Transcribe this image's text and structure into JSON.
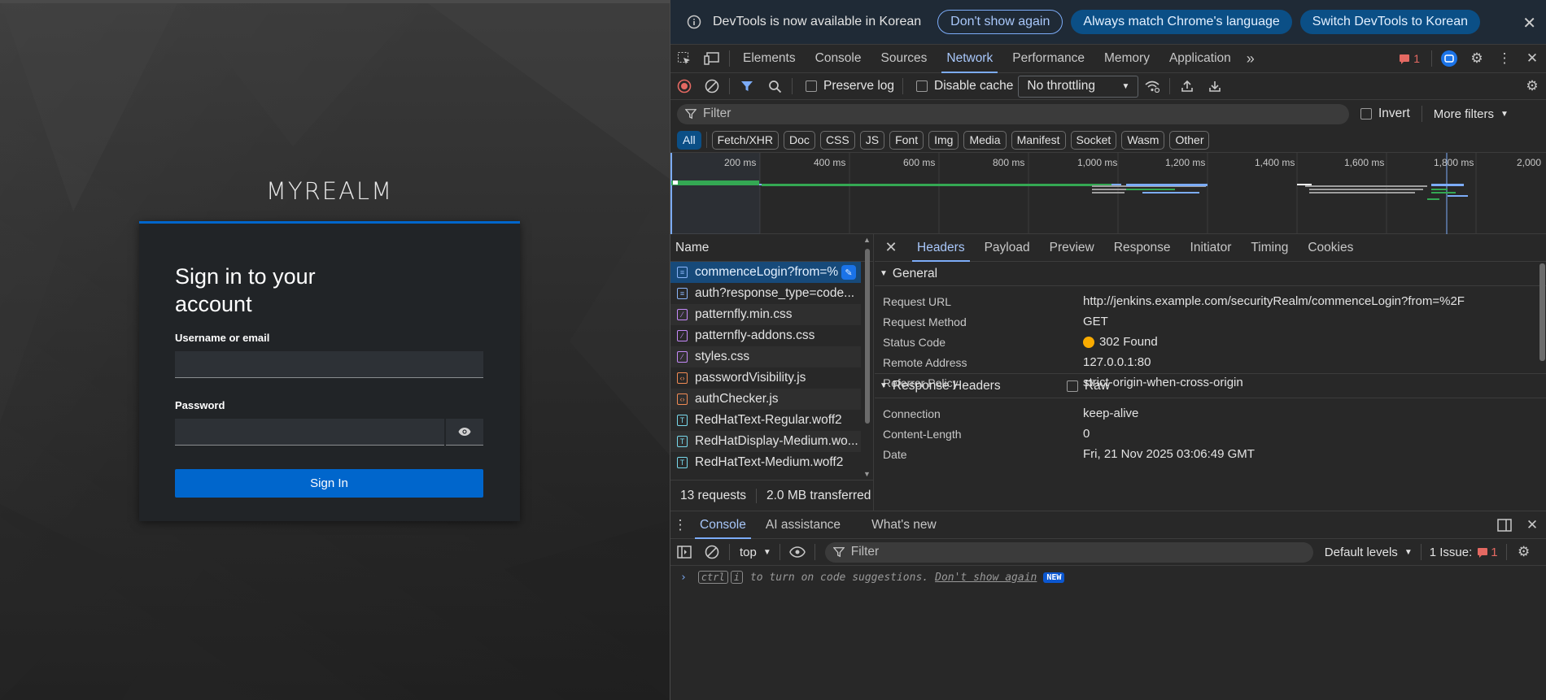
{
  "login": {
    "realm": "MYREALM",
    "heading": "Sign in to your account",
    "username_label": "Username or email",
    "username_value": "",
    "password_label": "Password",
    "password_value": "",
    "signin_label": "Sign In"
  },
  "infobar": {
    "message": "DevTools is now available in Korean",
    "dont_show": "Don't show again",
    "match_language": "Always match Chrome's language",
    "switch_korean": "Switch DevTools to Korean"
  },
  "tabs": [
    "Elements",
    "Console",
    "Sources",
    "Network",
    "Performance",
    "Memory",
    "Application"
  ],
  "active_tab": "Network",
  "issues_count": "1",
  "toolbar": {
    "preserve_log": "Preserve log",
    "disable_cache": "Disable cache",
    "throttling": "No throttling"
  },
  "filter": {
    "placeholder": "Filter",
    "invert": "Invert",
    "more_filters": "More filters"
  },
  "type_filters": [
    "All",
    "Fetch/XHR",
    "Doc",
    "CSS",
    "JS",
    "Font",
    "Img",
    "Media",
    "Manifest",
    "Socket",
    "Wasm",
    "Other"
  ],
  "timeline_ticks": [
    "200 ms",
    "400 ms",
    "600 ms",
    "800 ms",
    "1,000 ms",
    "1,200 ms",
    "1,400 ms",
    "1,600 ms",
    "1,800 ms",
    "2,000"
  ],
  "name_header": "Name",
  "requests": [
    {
      "name": "commenceLogin?from=%",
      "type": "doc"
    },
    {
      "name": "auth?response_type=code...",
      "type": "doc"
    },
    {
      "name": "patternfly.min.css",
      "type": "css"
    },
    {
      "name": "patternfly-addons.css",
      "type": "css"
    },
    {
      "name": "styles.css",
      "type": "css"
    },
    {
      "name": "passwordVisibility.js",
      "type": "js"
    },
    {
      "name": "authChecker.js",
      "type": "js"
    },
    {
      "name": "RedHatText-Regular.woff2",
      "type": "font"
    },
    {
      "name": "RedHatDisplay-Medium.wo...",
      "type": "font"
    },
    {
      "name": "RedHatText-Medium.woff2",
      "type": "font"
    }
  ],
  "status": {
    "requests": "13 requests",
    "transferred": "2.0 MB transferred"
  },
  "detail_tabs": [
    "Headers",
    "Payload",
    "Preview",
    "Response",
    "Initiator",
    "Timing",
    "Cookies"
  ],
  "general": {
    "title": "General",
    "rows": [
      {
        "k": "Request URL",
        "v": "http://jenkins.example.com/securityRealm/commenceLogin?from=%2F"
      },
      {
        "k": "Request Method",
        "v": "GET"
      },
      {
        "k": "Status Code",
        "v": "302 Found"
      },
      {
        "k": "Remote Address",
        "v": "127.0.0.1:80"
      },
      {
        "k": "Referrer Policy",
        "v": "strict-origin-when-cross-origin"
      }
    ]
  },
  "response_headers": {
    "title": "Response Headers",
    "raw": "Raw",
    "rows": [
      {
        "k": "Connection",
        "v": "keep-alive"
      },
      {
        "k": "Content-Length",
        "v": "0"
      },
      {
        "k": "Date",
        "v": "Fri, 21 Nov 2025 03:06:49 GMT"
      }
    ]
  },
  "drawer": {
    "tabs": [
      "Console",
      "AI assistance",
      "What's new"
    ],
    "context": "top",
    "filter_placeholder": "Filter",
    "levels": "Default levels",
    "issues": "1 Issue:",
    "issues_count": "1",
    "hint_keys": [
      "ctrl",
      "i"
    ],
    "hint_text": "to turn on code suggestions.",
    "hint_link": "Don't show again",
    "hint_badge": "NEW"
  },
  "colors": {
    "accent": "#7cacf8",
    "primary_button": "#0066cc",
    "status_302": "#f9ab00"
  }
}
